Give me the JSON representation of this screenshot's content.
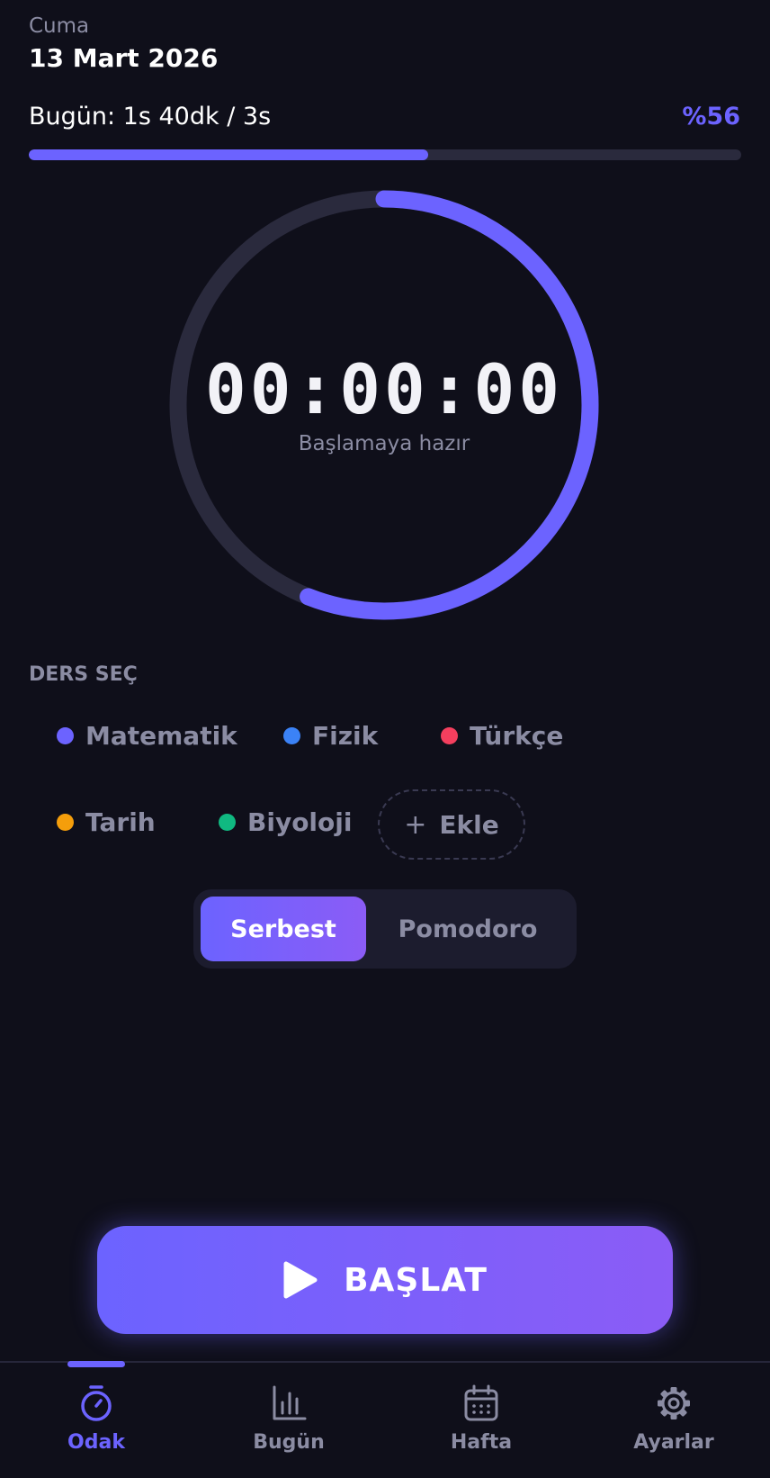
{
  "header": {
    "day_name": "Cuma",
    "date": "13 Mart 2026",
    "today_label": "Bugün: 1s 40dk / 3s",
    "today_percent": "%56",
    "progress_fraction": 0.56
  },
  "timer": {
    "time": "00:00:00",
    "status": "Başlamaya hazır",
    "ring_progress_fraction": 0.56
  },
  "subjects": {
    "title": "DERS SEÇ",
    "items": [
      {
        "label": "Matematik",
        "color": "#6c63ff"
      },
      {
        "label": "Fizik",
        "color": "#3b82f6"
      },
      {
        "label": "Türkçe",
        "color": "#f43f5e"
      },
      {
        "label": "Tarih",
        "color": "#f59e0b"
      },
      {
        "label": "Biyoloji",
        "color": "#10b981"
      }
    ],
    "add_label": "Ekle"
  },
  "mode": {
    "options": [
      "Serbest",
      "Pomodoro"
    ],
    "selected": "Serbest"
  },
  "start_button": {
    "label": "BAŞLAT",
    "icon": "play-icon"
  },
  "nav": {
    "items": [
      {
        "label": "Odak",
        "icon": "stopwatch-icon",
        "active": true
      },
      {
        "label": "Bugün",
        "icon": "bar-chart-icon",
        "active": false
      },
      {
        "label": "Hafta",
        "icon": "calendar-icon",
        "active": false
      },
      {
        "label": "Ayarlar",
        "icon": "gear-icon",
        "active": false
      }
    ]
  },
  "colors": {
    "accent": "#6c63ff",
    "background": "#0f0f1a",
    "muted": "#8b8ca3"
  }
}
